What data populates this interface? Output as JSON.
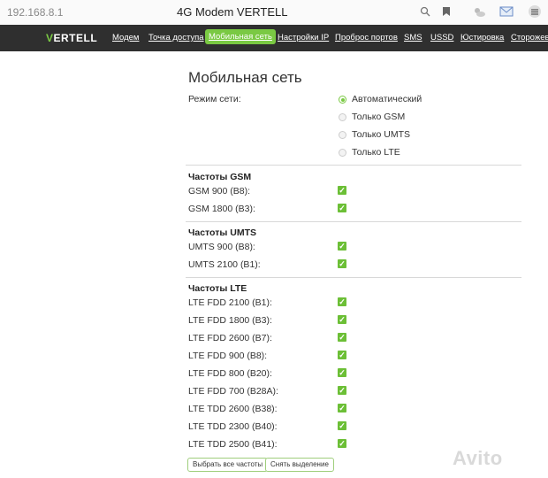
{
  "browser": {
    "url": "192.168.8.1",
    "tab_title": "4G Modem VERTELL",
    "icons": [
      "search-icon",
      "bookmark-icon",
      "weather-icon",
      "mail-icon",
      "profile-icon"
    ]
  },
  "nav": {
    "logo_v": "V",
    "logo_rest": "ERTELL",
    "items": [
      "Модем",
      "Точка доступа",
      "Мобильная сеть",
      "Настройки IP",
      "Проброс портов",
      "SMS",
      "USSD",
      "Юстировка",
      "Сторожевой"
    ],
    "active_index": 2,
    "accent_color": "#7ac943"
  },
  "page": {
    "title": "Мобильная сеть",
    "network_mode_label": "Режим сети:",
    "network_modes": [
      {
        "label": "Автоматический",
        "selected": true
      },
      {
        "label": "Только GSM",
        "selected": false
      },
      {
        "label": "Только UMTS",
        "selected": false
      },
      {
        "label": "Только LTE",
        "selected": false
      }
    ],
    "gsm": {
      "heading": "Частоты GSM",
      "bands": [
        {
          "label": "GSM 900 (B8):",
          "checked": true
        },
        {
          "label": "GSM 1800 (B3):",
          "checked": true
        }
      ]
    },
    "umts": {
      "heading": "Частоты UMTS",
      "bands": [
        {
          "label": "UMTS 900 (B8):",
          "checked": true
        },
        {
          "label": "UMTS 2100 (B1):",
          "checked": true
        }
      ]
    },
    "lte": {
      "heading": "Частоты LTE",
      "bands": [
        {
          "label": "LTE FDD 2100 (B1):",
          "checked": true
        },
        {
          "label": "LTE FDD 1800 (B3):",
          "checked": true
        },
        {
          "label": "LTE FDD 2600 (B7):",
          "checked": true
        },
        {
          "label": "LTE FDD 900 (B8):",
          "checked": true
        },
        {
          "label": "LTE FDD 800 (B20):",
          "checked": true
        },
        {
          "label": "LTE FDD 700 (B28A):",
          "checked": true
        },
        {
          "label": "LTE TDD 2600 (B38):",
          "checked": true
        },
        {
          "label": "LTE TDD 2300 (B40):",
          "checked": true
        },
        {
          "label": "LTE TDD 2500 (B41):",
          "checked": true
        }
      ]
    },
    "select_all_label": "Выбрать все частоты",
    "clear_label": "Снять выделение",
    "check_glyph": "✓"
  },
  "watermark": "Avito"
}
